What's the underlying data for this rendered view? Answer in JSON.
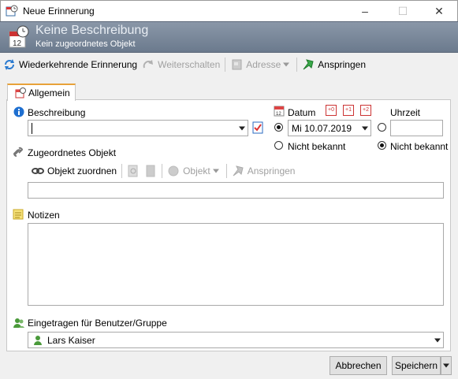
{
  "window": {
    "title": "Neue Erinnerung",
    "controls": [
      "–",
      "☐",
      "✕"
    ]
  },
  "header": {
    "title": "Keine Beschreibung",
    "subtitle": "Kein zugeordnetes Objekt"
  },
  "toolbar": {
    "recurring": "Wiederkehrende Erinnerung",
    "forward": "Weiterschalten",
    "address": "Adresse",
    "jump": "Anspringen"
  },
  "tabs": [
    {
      "label": "Allgemein"
    }
  ],
  "form": {
    "beschreibung_label": "Beschreibung",
    "beschreibung_value": "",
    "datum_label": "Datum",
    "datum_value": "Mi 10.07.2019",
    "uhrzeit_label": "Uhrzeit",
    "uhrzeit_value": "",
    "nicht_bekannt_date": "Nicht bekannt",
    "nicht_bekannt_time": "Nicht bekannt",
    "date_buttons": [
      "12",
      "+0",
      "+1",
      "+2"
    ],
    "objekt_label": "Zugeordnetes Objekt",
    "objekt_zuordnen": "Objekt zuordnen",
    "objekt_dropdown": "Objekt",
    "objekt_anspringen": "Anspringen",
    "objekt_value": "",
    "notizen_label": "Notizen",
    "notizen_value": "",
    "benutzer_label": "Eingetragen für Benutzer/Gruppe",
    "benutzer_value": "Lars Kaiser"
  },
  "footer": {
    "cancel": "Abbrechen",
    "save": "Speichern"
  },
  "colors": {
    "header_bg": "#7b889b",
    "tab_accent": "#e8a23a",
    "info_blue": "#1e6fd0"
  }
}
